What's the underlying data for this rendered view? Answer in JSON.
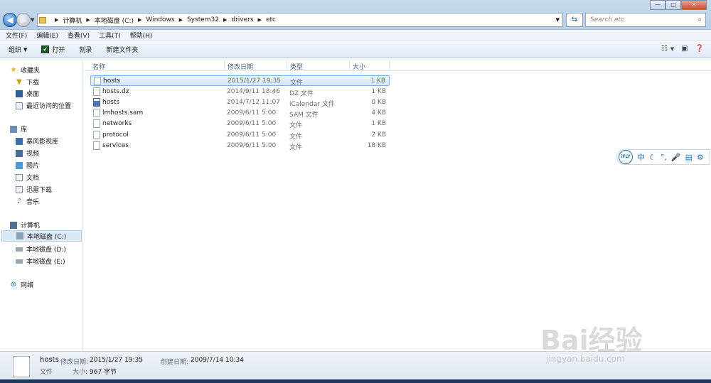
{
  "address": {
    "crumbs": [
      "计算机",
      "本地磁盘 (C:)",
      "Windows",
      "System32",
      "drivers",
      "etc"
    ]
  },
  "search": {
    "placeholder": "Search etc"
  },
  "window_controls": [
    "—",
    "□",
    "✕"
  ],
  "menu": [
    "文件(F)",
    "编辑(E)",
    "查看(V)",
    "工具(T)",
    "帮助(H)"
  ],
  "toolbar": {
    "organize": "组织",
    "open": "打开",
    "burn": "刻录",
    "new_folder": "新建文件夹"
  },
  "sidebar": {
    "favorites": {
      "label": "收藏夹",
      "items": [
        "下载",
        "桌面",
        "最近访问的位置"
      ]
    },
    "libraries": {
      "label": "库",
      "items": [
        "暴风影视库",
        "视频",
        "图片",
        "文档",
        "迅雷下载",
        "音乐"
      ]
    },
    "computer": {
      "label": "计算机",
      "items": [
        "本地磁盘 (C:)",
        "本地磁盘 (D:)",
        "本地磁盘 (E:)"
      ]
    },
    "network": {
      "label": "网络"
    }
  },
  "columns": [
    "名称",
    "修改日期",
    "类型",
    "大小"
  ],
  "files": [
    {
      "name": "hosts",
      "date": "2015/1/27 19:35",
      "type": "文件",
      "size": "1 KB",
      "icon": "file-icon"
    },
    {
      "name": "hosts.dz",
      "date": "2014/9/11 18:46",
      "type": "DZ 文件",
      "size": "1 KB",
      "icon": "file-icon"
    },
    {
      "name": "hosts",
      "date": "2014/7/12 11:07",
      "type": "iCalendar 文件",
      "size": "0 KB",
      "icon": "calendar-file-icon"
    },
    {
      "name": "lmhosts.sam",
      "date": "2009/6/11 5:00",
      "type": "SAM 文件",
      "size": "4 KB",
      "icon": "file-icon"
    },
    {
      "name": "networks",
      "date": "2009/6/11 5:00",
      "type": "文件",
      "size": "1 KB",
      "icon": "file-icon"
    },
    {
      "name": "protocol",
      "date": "2009/6/11 5:00",
      "type": "文件",
      "size": "2 KB",
      "icon": "file-icon"
    },
    {
      "name": "services",
      "date": "2009/6/11 5:00",
      "type": "文件",
      "size": "18 KB",
      "icon": "file-icon"
    }
  ],
  "ime": {
    "logo": "iFLY",
    "keys": [
      "中",
      "☾",
      "°,",
      "🎤",
      "▤",
      "⚙"
    ]
  },
  "details": {
    "name": "hosts",
    "modified_label": "修改日期:",
    "modified": "2015/1/27 19:35",
    "created_label": "创建日期:",
    "created": "2009/7/14 10:34",
    "type": "文件",
    "size_label": "大小:",
    "size": "967 字节"
  },
  "watermark": {
    "text": "Bai经验",
    "url": "jingyan.baidu.com"
  },
  "colors": {
    "selection": "#d6e8fb",
    "accent": "#1a73c8",
    "titlebar": "#b5cde6"
  }
}
